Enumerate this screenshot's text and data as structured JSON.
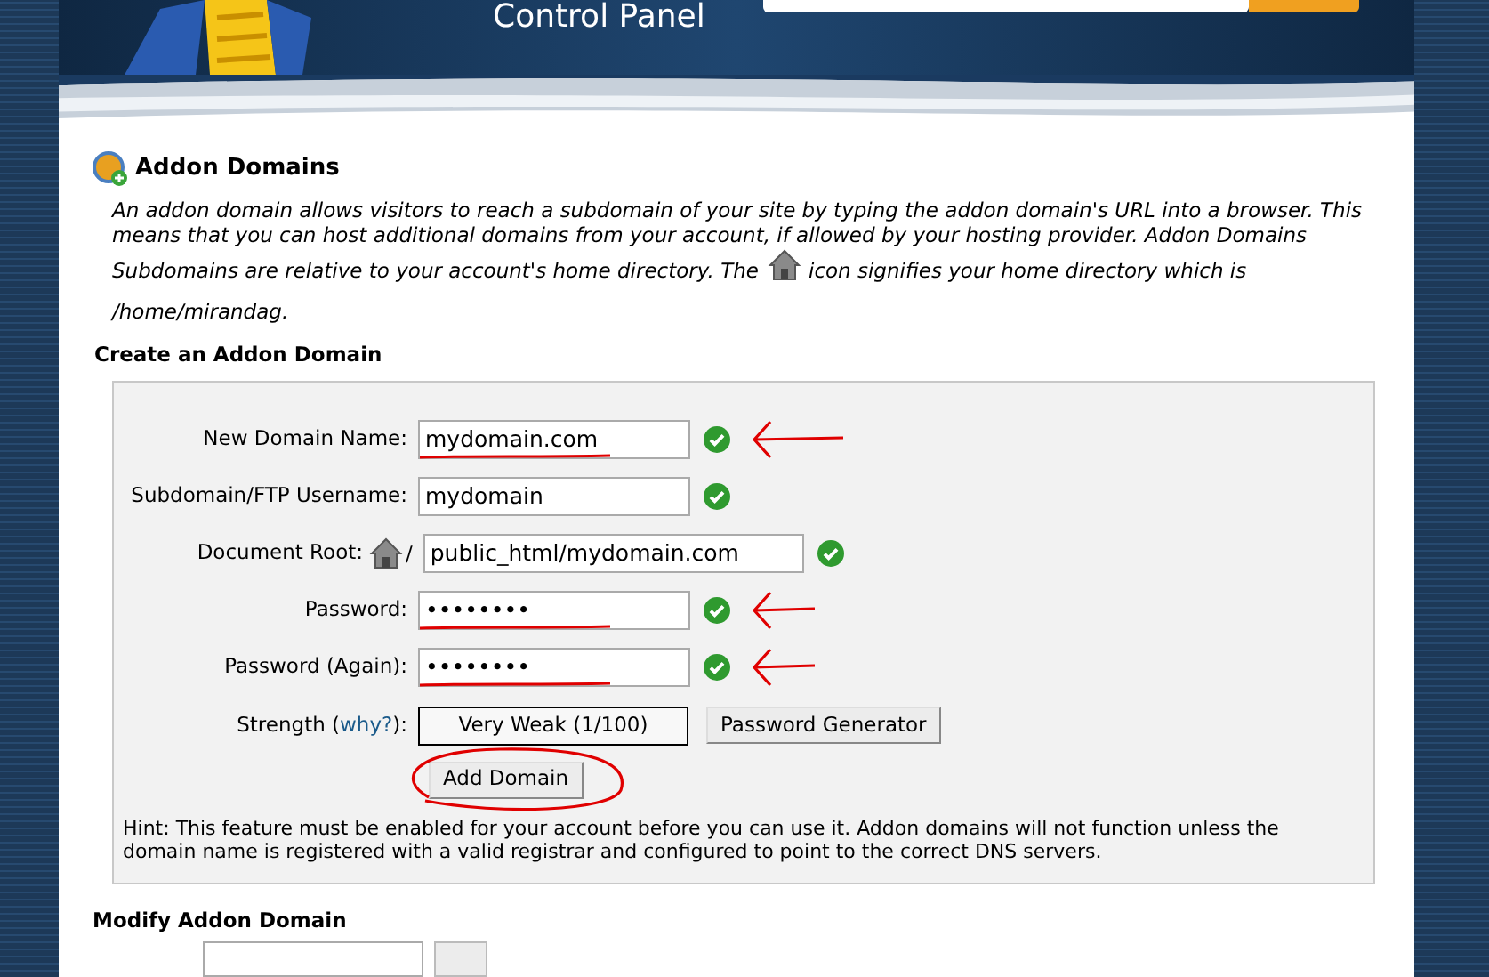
{
  "header": {
    "title": "Control Panel"
  },
  "page": {
    "title": "Addon Domains",
    "description_lines": [
      "An addon domain allows visitors to reach a subdomain of your site by typing the addon domain's URL into a browser. This",
      "means that you can host additional domains from your account, if allowed by your hosting provider. Addon Domains"
    ],
    "description_before": "Subdomains are relative to your account's home directory. The",
    "description_after": "icon signifies your home directory which is",
    "home_path": "/home/mirandag."
  },
  "create": {
    "heading": "Create an Addon Domain",
    "fields": [
      {
        "kind": "text",
        "label": "New Domain Name:",
        "value": "mydomain.com",
        "valid": true,
        "annotated": true
      },
      {
        "kind": "text",
        "label": "Subdomain/FTP Username:",
        "value": "mydomain",
        "valid": true,
        "annotated": false
      },
      {
        "kind": "root",
        "label": "Document Root:",
        "prefix": "/",
        "value": "public_html/mydomain.com",
        "valid": true,
        "annotated": false
      },
      {
        "kind": "text",
        "label": "Password:",
        "value": "••••••••",
        "valid": true,
        "annotated": true
      },
      {
        "kind": "text",
        "label": "Password (Again):",
        "value": "••••••••",
        "valid": true,
        "annotated": true
      }
    ],
    "strength": {
      "label_before": "Strength (",
      "link": "why?",
      "label_after": "):",
      "meter": "Very Weak (1/100)",
      "generator_button": "Password Generator"
    },
    "submit": {
      "label": "Add Domain",
      "circled": true
    },
    "hint": "Hint: This feature must be enabled for your account before you can use it. Addon domains will not function unless the domain name is registered with a valid registrar and configured to point to the correct DNS servers."
  },
  "modify": {
    "heading": "Modify Addon Domain"
  }
}
